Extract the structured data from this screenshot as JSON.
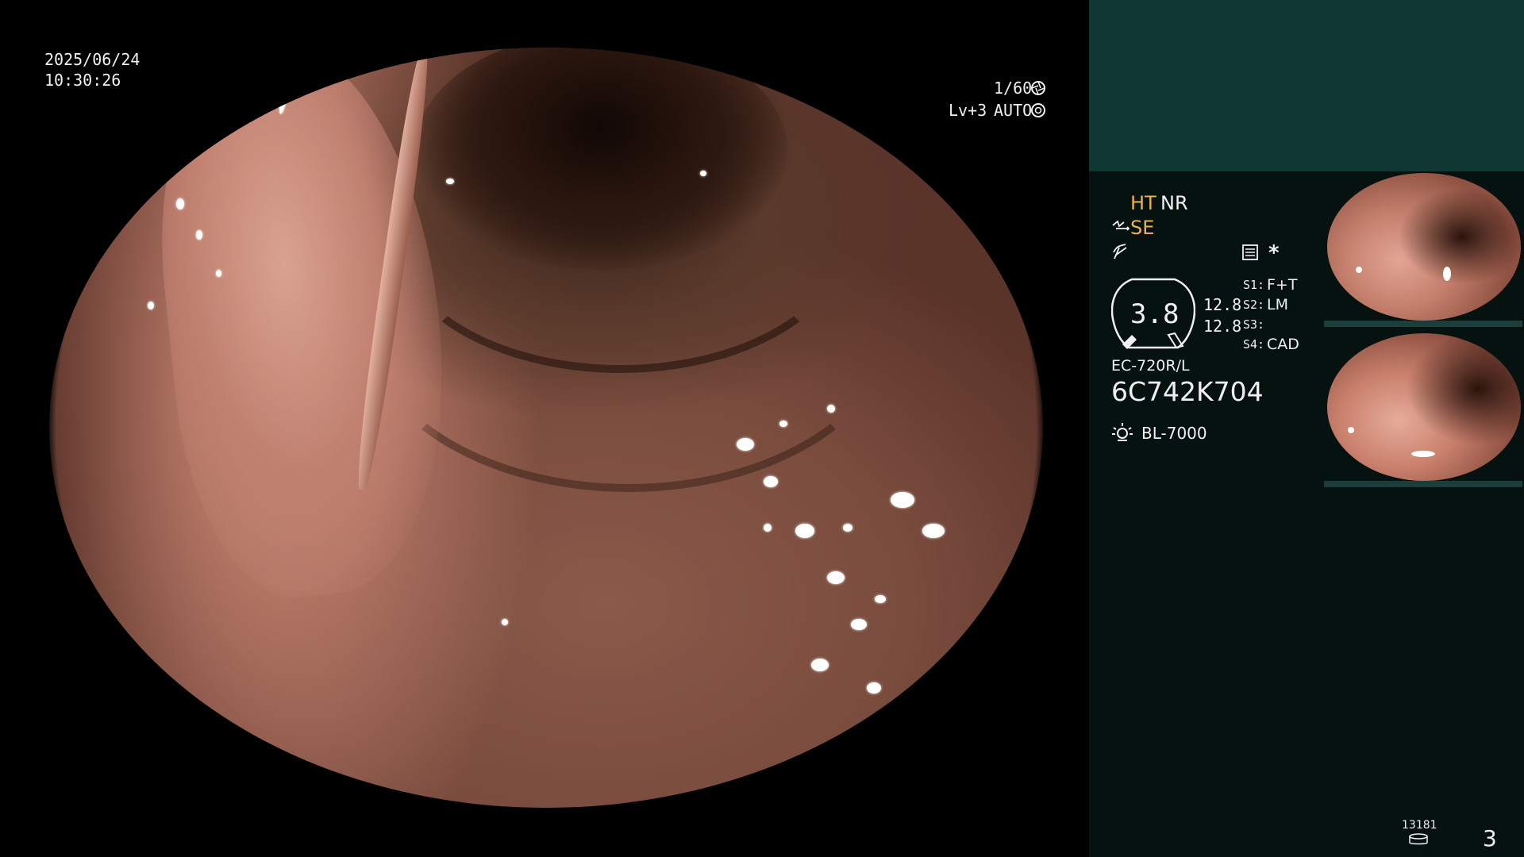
{
  "overlay": {
    "date": "2025/06/24",
    "time": "10:30:26",
    "shutter": "1/60",
    "iris_level": "Lv+3",
    "iris_mode": "AUTO"
  },
  "panel": {
    "ht": "HT",
    "nr": "NR",
    "se": "SE",
    "zoom_value": "3.8",
    "scale_top": "12.8",
    "scale_bottom": "12.8",
    "switches": [
      {
        "key": "S1:",
        "value": "F+T"
      },
      {
        "key": "S2:",
        "value": "LM"
      },
      {
        "key": "S3:",
        "value": ""
      },
      {
        "key": "S4:",
        "value": "CAD"
      }
    ],
    "asterisk": "*",
    "scope_model": "EC-720R/L",
    "scope_serial": "6C742K704",
    "light_source": "BL-7000",
    "storage_count": "13181",
    "image_count": "3"
  },
  "colors": {
    "panel_bg": "#061210",
    "panel_top": "#0f3835",
    "accent_orange": "#f0b43c",
    "text": "#f0f0f0"
  }
}
